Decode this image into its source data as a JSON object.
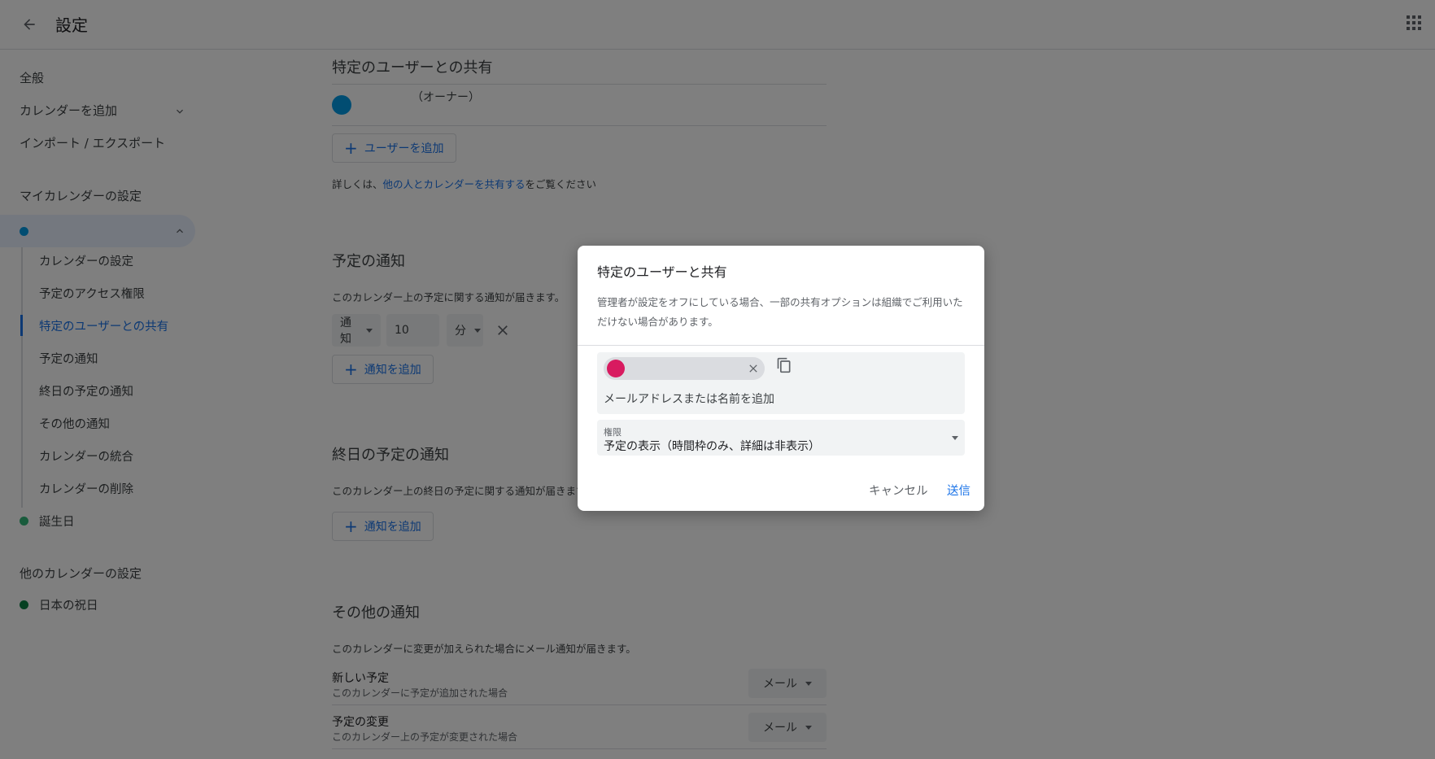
{
  "header": {
    "title": "設定",
    "back_icon": "arrow-back-icon",
    "apps_icon": "apps-grid-icon"
  },
  "sidebar": {
    "general": "全般",
    "add_calendar": "カレンダーを追加",
    "import_export": "インポート / エクスポート",
    "my_calendars_heading": "マイカレンダーの設定",
    "my_calendar_color": "#039be5",
    "sub_items": [
      "カレンダーの設定",
      "予定のアクセス権限",
      "特定のユーザーとの共有",
      "予定の通知",
      "終日の予定の通知",
      "その他の通知",
      "カレンダーの統合",
      "カレンダーの削除"
    ],
    "birthday": "誕生日",
    "birthday_color": "#33b679",
    "other_calendars_heading": "他のカレンダーの設定",
    "japan_holidays": "日本の祝日",
    "japan_holidays_color": "#0b8043"
  },
  "main": {
    "sharing": {
      "title": "特定のユーザーとの共有",
      "owner_label": "（オーナー）",
      "add_user": "ユーザーを追加",
      "help_prefix": "詳しくは、",
      "help_link": "他の人とカレンダーを共有する",
      "help_suffix": "をご覧ください"
    },
    "event_notifications": {
      "title": "予定の通知",
      "desc": "このカレンダー上の予定に関する通知が届きます。",
      "type": "通知",
      "amount": "10",
      "unit": "分",
      "add": "通知を追加"
    },
    "allday_notifications": {
      "title": "終日の予定の通知",
      "desc": "このカレンダー上の終日の予定に関する通知が届きます。",
      "add": "通知を追加"
    },
    "other_notifications": {
      "title": "その他の通知",
      "desc": "このカレンダーに変更が加えられた場合にメール通知が届きます。",
      "rows": [
        {
          "title": "新しい予定",
          "sub": "このカレンダーに予定が追加された場合",
          "value": "メール"
        },
        {
          "title": "予定の変更",
          "sub": "このカレンダー上の予定が変更された場合",
          "value": "メール"
        }
      ]
    }
  },
  "dialog": {
    "title": "特定のユーザーと共有",
    "note": "管理者が設定をオフにしている場合、一部の共有オプションは組織でご利用いただけない場合があります。",
    "chip_color": "#d81b60",
    "input_placeholder": "メールアドレスまたは名前を追加",
    "permission_label": "権限",
    "permission_value": "予定の表示（時間枠のみ、詳細は非表示）",
    "cancel": "キャンセル",
    "send": "送信"
  }
}
